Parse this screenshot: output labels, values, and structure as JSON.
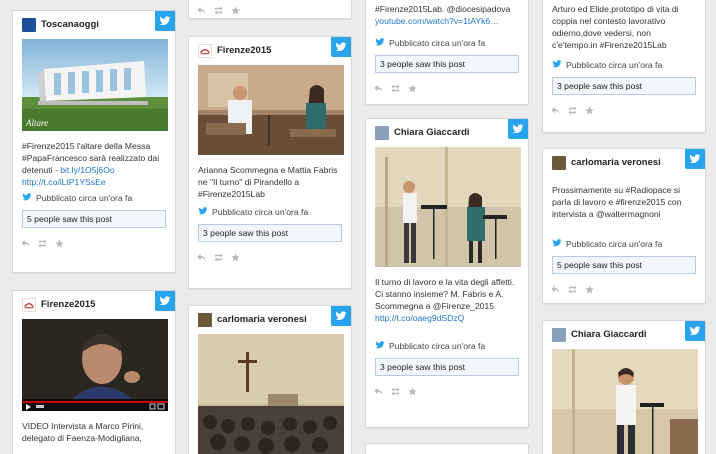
{
  "meta_text": "Pubblicato circa un'ora fa",
  "cards": {
    "c1": {
      "author": "Toscanaoggi",
      "caption": "Altare",
      "text": "#Firenze2015 l'altare della Messa #PapaFrancesco sarà realizzato dai detenuti - ",
      "link1": "bit.ly/1O5j6Oo",
      "link2": "http://t.co/iLtP1YSsEe",
      "seen": "5 people saw this post"
    },
    "c2": {
      "author": "Firenze2015",
      "text": "VIDEO Intervista a Marco Pirini, delegato di Faenza-Modigliana,"
    },
    "c3": {
      "author": "Firenze2015",
      "text": "Arianna Scommegna e Mattia Fabris ne \"Il turno\" di Pirandello a #Firenze2015Lab",
      "seen": "3 people saw this post"
    },
    "c4": {
      "author": "carlomaria veronesi"
    },
    "c5": {
      "text_top": "#Firenze2015Lab. @diocesipadova",
      "link_top": "youtube.com/watch?v=1tAYk6…",
      "seen": "3 people saw this post"
    },
    "c6": {
      "author": "Chiara Giaccardi",
      "text": "Il turno di lavoro e la vita degli affetti. Ci stanno insieme? M. Fabris e A. Scommegna a @Firenze_2015",
      "link": "http://t.co/oaeg9dSDzQ",
      "seen": "3 people saw this post"
    },
    "c7": {
      "text_top": "Arturo ed Elide,prototipo di vita di coppia nel contesto lavorativo odierno,dove vedersi, non c'e'tempo.in #Firenze2015Lab",
      "seen": "3 people saw this post"
    },
    "c8": {
      "author": "carlomaria veronesi",
      "text": "Prossimamente su #Radiopace si parla di lavoro e #firenze2015 con intervista a @waltermagnoni",
      "seen": "5 people saw this post"
    },
    "c9": {
      "author": "Chiara Giaccardi"
    }
  },
  "colors": {
    "twitter": "#2aa3ef",
    "link": "#1b76c9",
    "seen_border": "#b9c9e6"
  }
}
